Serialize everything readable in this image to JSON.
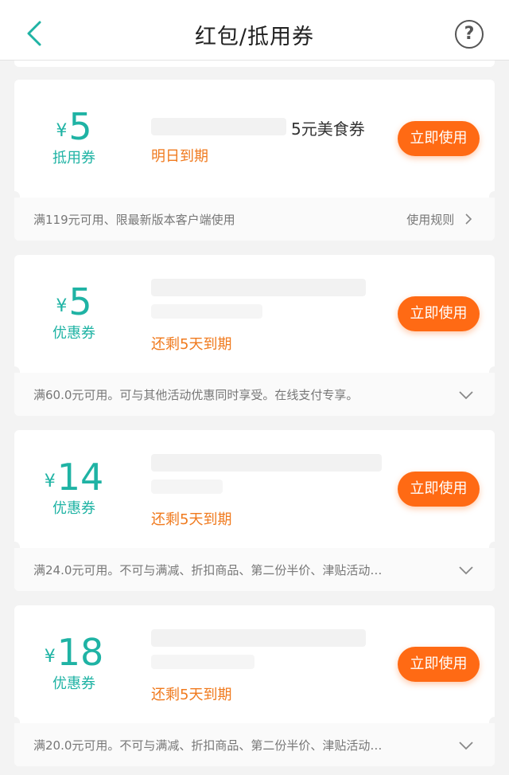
{
  "nav": {
    "title": "红包/抵用券"
  },
  "cards": [
    {
      "currency": "¥",
      "amount": "5",
      "kind": "抵用券",
      "title_suffix": "5元美食券",
      "expire": "明日到期",
      "button": "立即使用",
      "rule": "满119元可用、限最新版本客户端使用",
      "rule_link": "使用规则"
    },
    {
      "currency": "¥",
      "amount": "5",
      "kind": "优惠券",
      "expire": "还剩5天到期",
      "button": "立即使用",
      "rule": "满60.0元可用。可与其他活动优惠同时享受。在线支付专享。"
    },
    {
      "currency": "¥",
      "amount": "14",
      "kind": "优惠券",
      "expire": "还剩5天到期",
      "button": "立即使用",
      "rule": "满24.0元可用。不可与满减、折扣商品、第二份半价、津贴活动…"
    },
    {
      "currency": "¥",
      "amount": "18",
      "kind": "优惠券",
      "expire": "还剩5天到期",
      "button": "立即使用",
      "rule": "满20.0元可用。不可与满减、折扣商品、第二份半价、津贴活动…"
    }
  ],
  "colors": {
    "accent_teal": "#1fb3a4",
    "button_orange": "#ff6a14",
    "expire_orange": "#f07a1e",
    "background": "#f3f3f3"
  }
}
